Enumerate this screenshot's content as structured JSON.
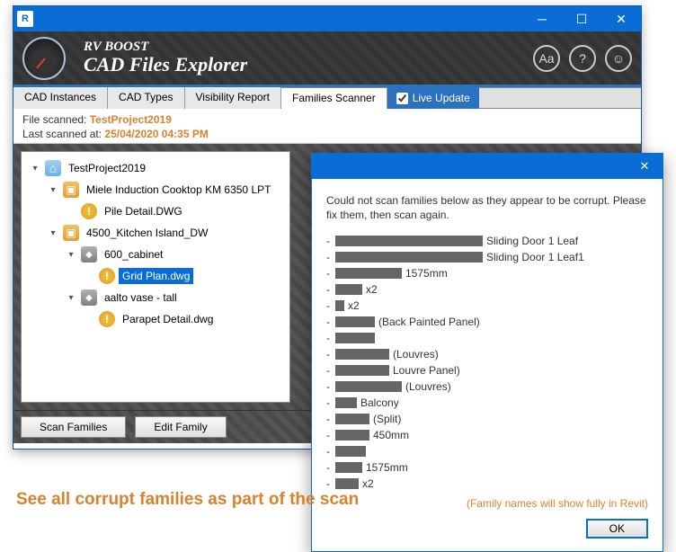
{
  "window": {
    "brand_line1": "RV BOOST",
    "brand_line2": "CAD Files Explorer"
  },
  "header_icons": [
    "text-size-icon",
    "help-icon",
    "users-icon"
  ],
  "tabs": [
    {
      "label": "CAD Instances",
      "active": false
    },
    {
      "label": "CAD Types",
      "active": false
    },
    {
      "label": "Visibility Report",
      "active": false
    },
    {
      "label": "Families Scanner",
      "active": true
    }
  ],
  "live_update": {
    "label": "Live Update",
    "checked": true
  },
  "info": {
    "file_scanned_label": "File scanned:",
    "file_scanned_value": "TestProject2019",
    "last_scanned_label": "Last scanned at:",
    "last_scanned_value": "25/04/2020 04:35 PM"
  },
  "tree": [
    {
      "depth": 0,
      "expander": "▾",
      "icon": "house",
      "label": "TestProject2019",
      "selected": false
    },
    {
      "depth": 1,
      "expander": "▾",
      "icon": "box",
      "label": "Miele Induction Cooktop KM 6350 LPT",
      "selected": false
    },
    {
      "depth": 2,
      "expander": "",
      "icon": "warn",
      "label": "Pile Detail.DWG",
      "selected": false
    },
    {
      "depth": 1,
      "expander": "▾",
      "icon": "box",
      "label": "4500_Kitchen Island_DW",
      "selected": false
    },
    {
      "depth": 2,
      "expander": "▾",
      "icon": "grey",
      "label": "600_cabinet",
      "selected": false
    },
    {
      "depth": 3,
      "expander": "",
      "icon": "warn",
      "label": "Grid Plan.dwg",
      "selected": true
    },
    {
      "depth": 2,
      "expander": "▾",
      "icon": "grey",
      "label": "aalto vase - tall",
      "selected": false
    },
    {
      "depth": 3,
      "expander": "",
      "icon": "warn",
      "label": "Parapet Detail.dwg",
      "selected": false
    }
  ],
  "buttons": {
    "scan": "Scan Families",
    "edit": "Edit Family"
  },
  "dialog": {
    "message": "Could not scan families below as they appear to be corrupt. Please fix them, then scan again.",
    "items": [
      {
        "redact_w": 164,
        "suffix": "Sliding Door 1 Leaf"
      },
      {
        "redact_w": 164,
        "suffix": "Sliding Door 1 Leaf1"
      },
      {
        "redact_w": 74,
        "suffix": "1575mm"
      },
      {
        "redact_w": 30,
        "suffix": "x2"
      },
      {
        "redact_w": 10,
        "suffix": "x2"
      },
      {
        "redact_w": 44,
        "suffix": "(Back Painted Panel)"
      },
      {
        "redact_w": 44,
        "suffix": ""
      },
      {
        "redact_w": 60,
        "suffix": "(Louvres)"
      },
      {
        "redact_w": 60,
        "suffix": "Louvre Panel)"
      },
      {
        "redact_w": 74,
        "suffix": "(Louvres)"
      },
      {
        "redact_w": 24,
        "suffix": "Balcony"
      },
      {
        "redact_w": 38,
        "suffix": "(Split)"
      },
      {
        "redact_w": 38,
        "suffix": "450mm"
      },
      {
        "redact_w": 34,
        "suffix": ""
      },
      {
        "redact_w": 30,
        "suffix": "1575mm"
      },
      {
        "redact_w": 26,
        "suffix": "x2"
      }
    ],
    "note": "(Family names will show fully in Revit)",
    "ok": "OK"
  },
  "caption": "See all corrupt families as part of the scan"
}
